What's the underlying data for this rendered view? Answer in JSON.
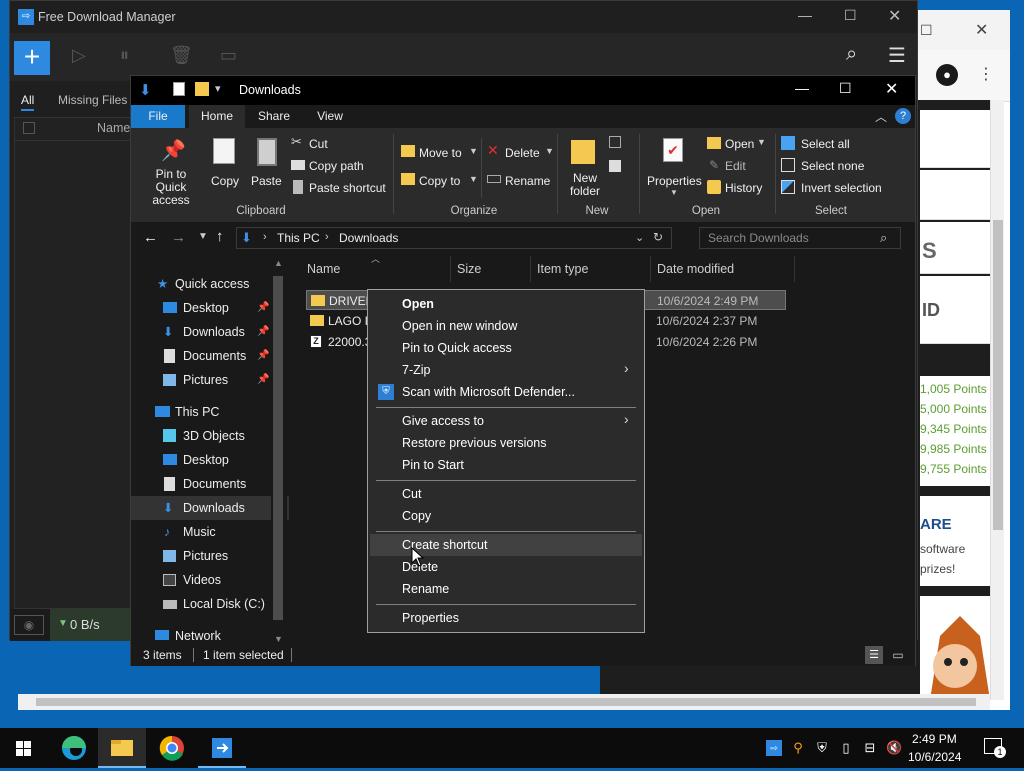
{
  "fdm": {
    "title": "Free Download Manager",
    "tabs": [
      "All",
      "Missing Files"
    ],
    "list_header": "Name",
    "speed": "0 B/s"
  },
  "explorer": {
    "title": "Downloads",
    "ribbon_tabs": [
      "File",
      "Home",
      "Share",
      "View"
    ],
    "clipboard": {
      "pin": "Pin to Quick access",
      "copy": "Copy",
      "paste": "Paste",
      "cut": "Cut",
      "copy_path": "Copy path",
      "paste_shortcut": "Paste shortcut",
      "group": "Clipboard"
    },
    "organize": {
      "move_to": "Move to",
      "copy_to": "Copy to",
      "delete": "Delete",
      "rename": "Rename",
      "group": "Organize"
    },
    "new": {
      "new_folder": "New folder",
      "group": "New"
    },
    "open": {
      "properties": "Properties",
      "open": "Open",
      "edit": "Edit",
      "history": "History",
      "group": "Open"
    },
    "select": {
      "select_all": "Select all",
      "select_none": "Select none",
      "invert": "Invert selection",
      "group": "Select"
    },
    "address": {
      "crumb1": "This PC",
      "crumb2": "Downloads"
    },
    "search_placeholder": "Search Downloads",
    "nav": [
      {
        "label": "Quick access",
        "pinned": false
      },
      {
        "label": "Desktop",
        "pinned": true
      },
      {
        "label": "Downloads",
        "pinned": true
      },
      {
        "label": "Documents",
        "pinned": true
      },
      {
        "label": "Pictures",
        "pinned": true
      },
      {
        "label": "This PC",
        "pinned": false
      },
      {
        "label": "3D Objects",
        "pinned": false
      },
      {
        "label": "Desktop",
        "pinned": false
      },
      {
        "label": "Documents",
        "pinned": false
      },
      {
        "label": "Downloads",
        "pinned": false
      },
      {
        "label": "Music",
        "pinned": false
      },
      {
        "label": "Pictures",
        "pinned": false
      },
      {
        "label": "Videos",
        "pinned": false
      },
      {
        "label": "Local Disk (C:)",
        "pinned": false
      },
      {
        "label": "Network",
        "pinned": false
      }
    ],
    "columns": [
      "Name",
      "Size",
      "Item type",
      "Date modified"
    ],
    "files": [
      {
        "name": "DRIVER",
        "date": "10/6/2024 2:49 PM"
      },
      {
        "name": "LAGO IS",
        "date": "10/6/2024 2:37 PM"
      },
      {
        "name": "22000.3",
        "date": "10/6/2024 2:26 PM"
      }
    ],
    "status": {
      "items": "3 items",
      "selected": "1 item selected"
    }
  },
  "context_menu": {
    "items": [
      "Open",
      "Open in new window",
      "Pin to Quick access",
      "7-Zip",
      "Scan with Microsoft Defender...",
      "Give access to",
      "Restore previous versions",
      "Pin to Start",
      "Cut",
      "Copy",
      "Create shortcut",
      "Delete",
      "Rename",
      "Properties"
    ]
  },
  "browser": {
    "points": [
      "1,005 Points",
      "5,000 Points",
      "9,345 Points",
      "9,985 Points",
      "9,755 Points"
    ],
    "banner_letter_1": "S",
    "banner_letter_2": "ID",
    "share_title": "ARE",
    "share_line1": "software",
    "share_line2": "prizes!"
  },
  "taskbar": {
    "time": "2:49 PM",
    "date": "10/6/2024",
    "notification_count": "1"
  },
  "colors": {
    "accent": "#0078d7",
    "selection": "#4d4d4d",
    "folder": "#f3c94f"
  }
}
